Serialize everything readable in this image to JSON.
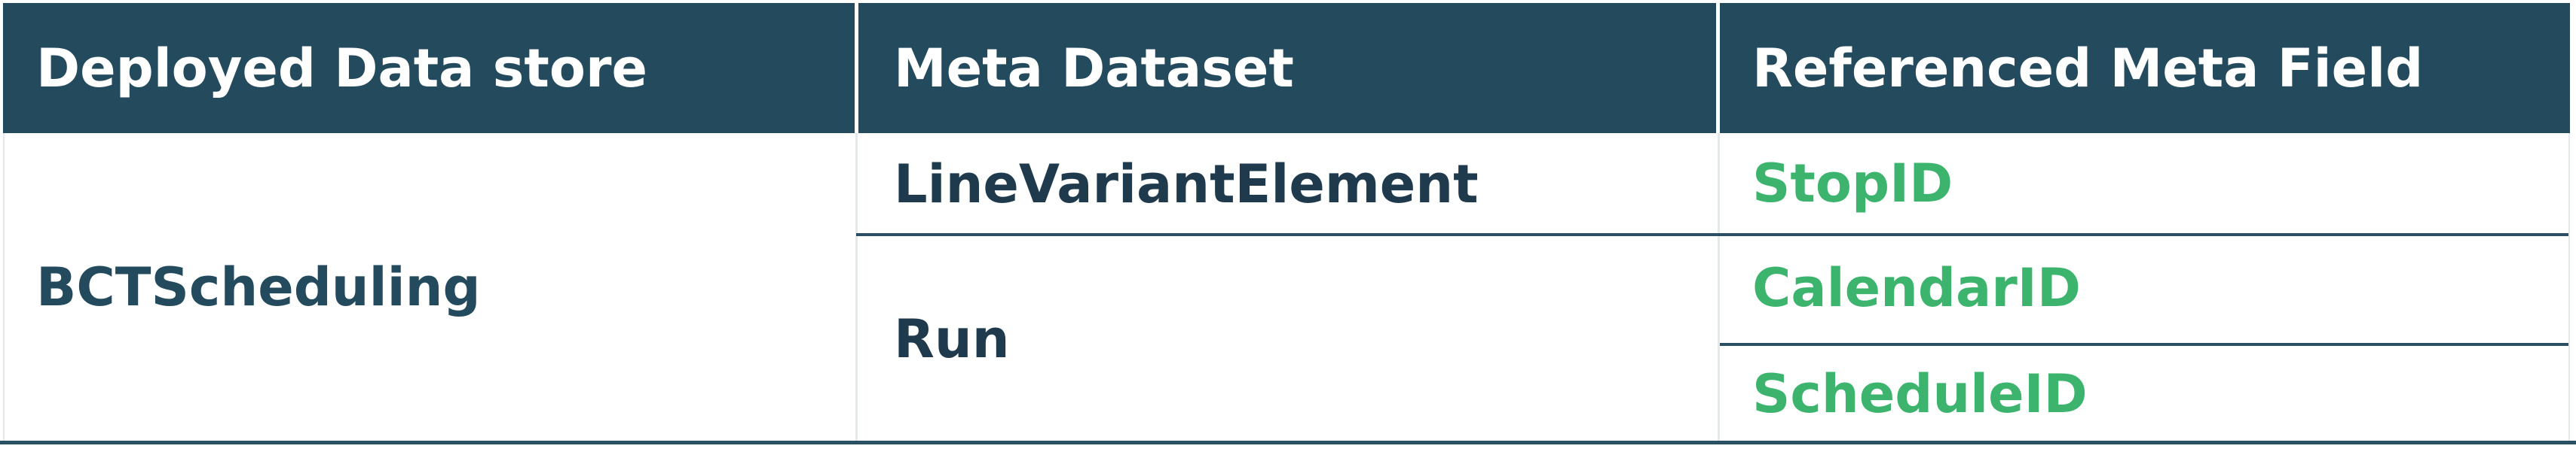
{
  "table": {
    "headers": [
      "Deployed Data store",
      "Meta Dataset",
      "Referenced Meta Field"
    ],
    "data_store": "BCTScheduling",
    "datasets": [
      {
        "name": "LineVariantElement",
        "fields": [
          "StopID"
        ]
      },
      {
        "name": "Run",
        "fields": [
          "CalendarID",
          "ScheduleID"
        ]
      }
    ]
  },
  "colors": {
    "header_bg": "#244a5e",
    "header_text": "#ffffff",
    "store_text": "#244a5e",
    "dataset_text": "#1f3a4c",
    "field_text": "#3cb46e",
    "rule_line": "#2b4f63"
  }
}
